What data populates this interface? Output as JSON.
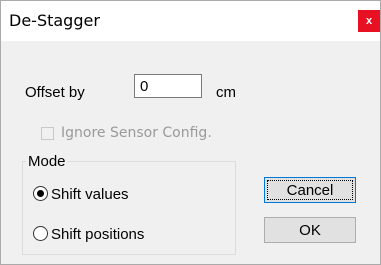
{
  "window": {
    "title": "De-Stagger",
    "close_glyph": "x"
  },
  "offset": {
    "label": "Offset by",
    "value": "0",
    "unit": "cm"
  },
  "ignore_sensor": {
    "label": "Ignore Sensor Config.",
    "checked": false,
    "enabled": false
  },
  "mode": {
    "group_label": "Mode",
    "options": [
      {
        "label": "Shift values",
        "selected": true
      },
      {
        "label": "Shift positions",
        "selected": false
      }
    ]
  },
  "buttons": {
    "cancel": "Cancel",
    "ok": "OK"
  },
  "colors": {
    "close_red": "#e81123",
    "focus_blue": "#0078d7",
    "disabled_text": "#9a9a9a"
  }
}
